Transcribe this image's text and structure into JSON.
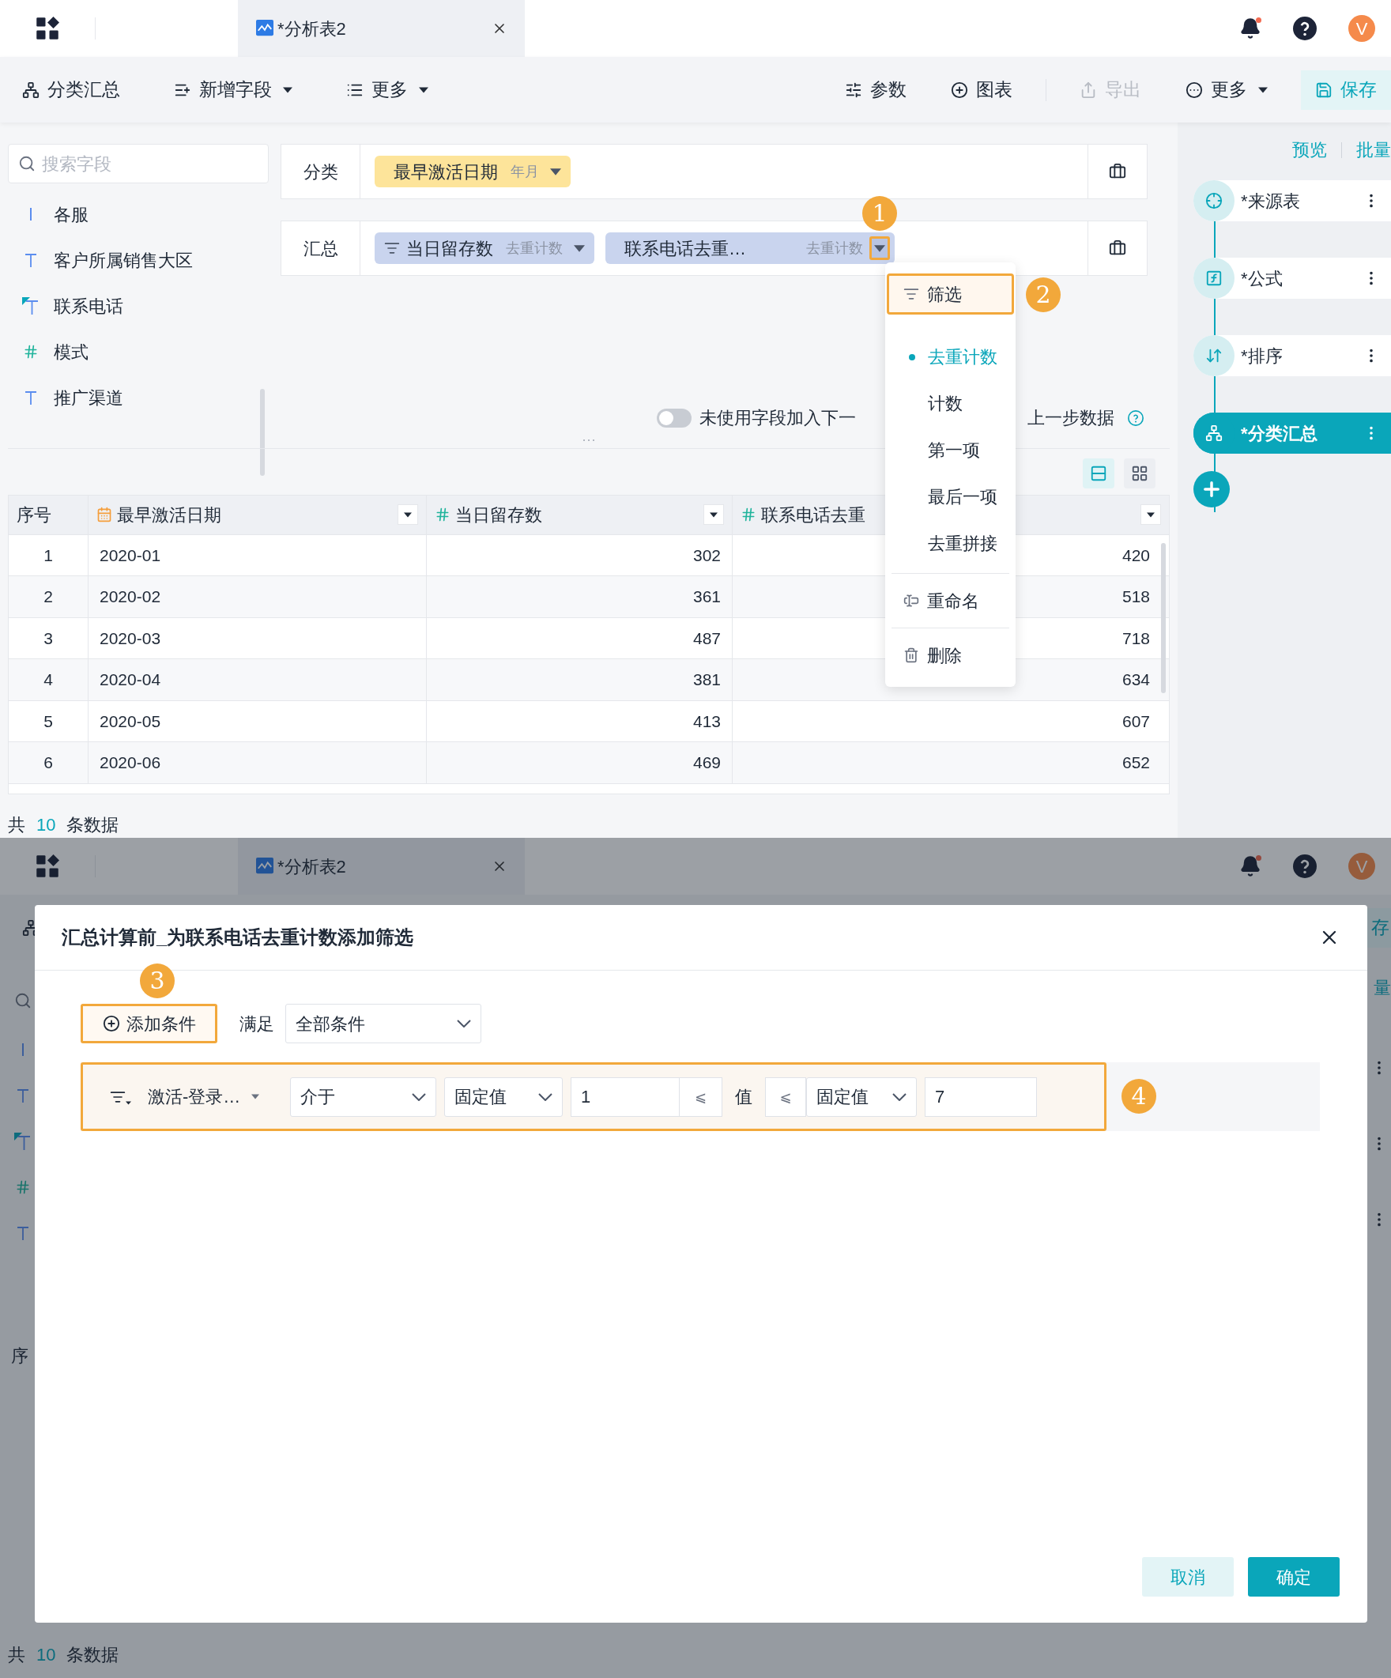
{
  "header": {
    "tab_title": "*分析表2",
    "avatar": "V"
  },
  "toolbar": {
    "left": [
      {
        "kind": "summary",
        "label": "分类汇总",
        "has_caret": false
      },
      {
        "kind": "add-field",
        "label": "新增字段",
        "has_caret": true
      },
      {
        "kind": "more",
        "label": "更多",
        "has_caret": true
      }
    ],
    "right": [
      {
        "kind": "params",
        "label": "参数",
        "disabled": false,
        "has_caret": false
      },
      {
        "kind": "chart",
        "label": "图表",
        "disabled": false,
        "has_caret": false
      },
      {
        "kind": "export",
        "label": "导出",
        "disabled": true,
        "has_caret": false
      },
      {
        "kind": "more",
        "label": "更多",
        "disabled": false,
        "has_caret": true
      },
      {
        "kind": "save",
        "label": "保存",
        "disabled": false,
        "has_caret": false
      }
    ]
  },
  "fields": {
    "search_placeholder": "搜索字段",
    "items": [
      {
        "kind": "partial",
        "name": "各服"
      },
      {
        "kind": "text",
        "name": "客户所属销售大区"
      },
      {
        "kind": "phone",
        "name": "联系电话"
      },
      {
        "kind": "number",
        "name": "模式"
      },
      {
        "kind": "text",
        "name": "推广渠道"
      }
    ]
  },
  "config": {
    "rows": [
      {
        "label": "分类",
        "chips": [
          {
            "kind": "dimension",
            "name": "最早激活日期",
            "agg": "年月",
            "has_filter": false,
            "menu_open": false
          }
        ]
      },
      {
        "label": "汇总",
        "chips": [
          {
            "kind": "measure",
            "name": "当日留存数",
            "agg": "去重计数",
            "has_filter": true,
            "menu_open": false
          },
          {
            "kind": "measure",
            "name": "联系电话去重…",
            "agg": "去重计数",
            "has_filter": false,
            "menu_open": true,
            "callout": "1"
          }
        ]
      }
    ],
    "toggle": {
      "on": false,
      "label_left": "未使用字段加入下一",
      "label_right": "上一步数据"
    }
  },
  "menu": {
    "groups": [
      [
        {
          "kind": "filter",
          "label": "筛选",
          "highlighted": true,
          "callout": "2"
        }
      ],
      [
        {
          "kind": "option",
          "label": "去重计数",
          "selected": true
        },
        {
          "kind": "option",
          "label": "计数",
          "selected": false
        },
        {
          "kind": "option",
          "label": "第一项",
          "selected": false
        },
        {
          "kind": "option",
          "label": "最后一项",
          "selected": false
        },
        {
          "kind": "option",
          "label": "去重拼接",
          "selected": false
        }
      ],
      [
        {
          "kind": "rename",
          "label": "重命名",
          "highlighted": false
        }
      ],
      [
        {
          "kind": "delete",
          "label": "删除",
          "highlighted": false
        }
      ]
    ]
  },
  "view_modes": [
    {
      "kind": "list",
      "selected": true
    },
    {
      "kind": "grid",
      "selected": false
    }
  ],
  "table": {
    "columns": [
      {
        "kind": "index",
        "label": "序号"
      },
      {
        "kind": "date",
        "label": "最早激活日期"
      },
      {
        "kind": "number",
        "label": "当日留存数"
      },
      {
        "kind": "number",
        "label": "联系电话去重"
      }
    ],
    "rows": [
      [
        "1",
        "2020-01",
        "302",
        "420"
      ],
      [
        "2",
        "2020-02",
        "361",
        "518"
      ],
      [
        "3",
        "2020-03",
        "487",
        "718"
      ],
      [
        "4",
        "2020-04",
        "381",
        "634"
      ],
      [
        "5",
        "2020-05",
        "413",
        "607"
      ],
      [
        "6",
        "2020-06",
        "469",
        "652"
      ]
    ]
  },
  "footer": {
    "prefix": "共",
    "count": "10",
    "suffix": "条数据"
  },
  "flow": {
    "links": [
      "预览",
      "批量"
    ],
    "nodes": [
      {
        "kind": "source",
        "label": "*来源表",
        "selected": false
      },
      {
        "kind": "formula",
        "label": "*公式",
        "selected": false
      },
      {
        "kind": "sort",
        "label": "*排序",
        "selected": false
      },
      {
        "kind": "group",
        "label": "*分类汇总",
        "selected": true
      }
    ]
  },
  "dialog_screen": {
    "header": {
      "tab_title": "*分析表2",
      "avatar": "V"
    },
    "save_fragment": "存",
    "batch_fragment": "量",
    "table_fragment": "序",
    "footer": {
      "prefix": "共",
      "count": "10",
      "suffix": "条数据"
    },
    "dialog": {
      "title": "汇总计算前_为联系电话去重计数添加筛选",
      "add_button": {
        "label": "添加条件",
        "callout": "3"
      },
      "match_label": "满足",
      "match_value": "全部条件",
      "conditions": [
        {
          "field": "激活-登录…",
          "operator": "介于",
          "lower_type": "固定值",
          "lower_value": "1",
          "lower_op": "⩽",
          "middle": "值",
          "upper_op": "⩽",
          "upper_type": "固定值",
          "upper_value": "7",
          "callout": "4"
        }
      ],
      "buttons": [
        {
          "kind": "secondary",
          "label": "取消"
        },
        {
          "kind": "primary",
          "label": "确定"
        }
      ]
    }
  }
}
